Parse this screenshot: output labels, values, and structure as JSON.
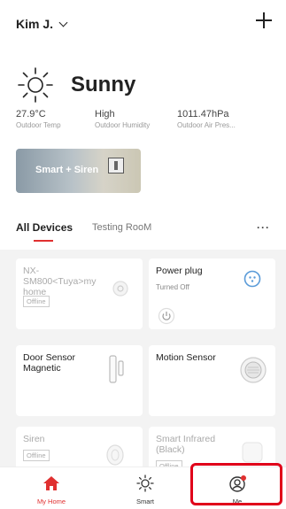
{
  "header": {
    "home_name": "Kim J."
  },
  "weather": {
    "condition": "Sunny",
    "stats": [
      {
        "value": "27.9°C",
        "label": "Outdoor Temp"
      },
      {
        "value": "High",
        "label": "Outdoor Humidity"
      },
      {
        "value": "1011.47hPa",
        "label": "Outdoor Air Pres..."
      }
    ]
  },
  "banner": {
    "text": "Smart + Siren"
  },
  "tabs": {
    "all": "All Devices",
    "room": "Testing RooM",
    "more": "···"
  },
  "devices": [
    {
      "name": "NX-SM800<Tuya>my home",
      "status": "Offline"
    },
    {
      "name": "Power plug",
      "status": "Turned Off"
    },
    {
      "name": "Door Sensor Magnetic"
    },
    {
      "name": "Motion Sensor"
    },
    {
      "name": "Siren",
      "status": "Offline"
    },
    {
      "name": "Smart Infrared (Black)",
      "status": "Offline"
    }
  ],
  "tabbar": {
    "items": [
      {
        "label": "My Home"
      },
      {
        "label": "Smart"
      },
      {
        "label": "Me"
      }
    ],
    "active_color": "#e03030"
  }
}
